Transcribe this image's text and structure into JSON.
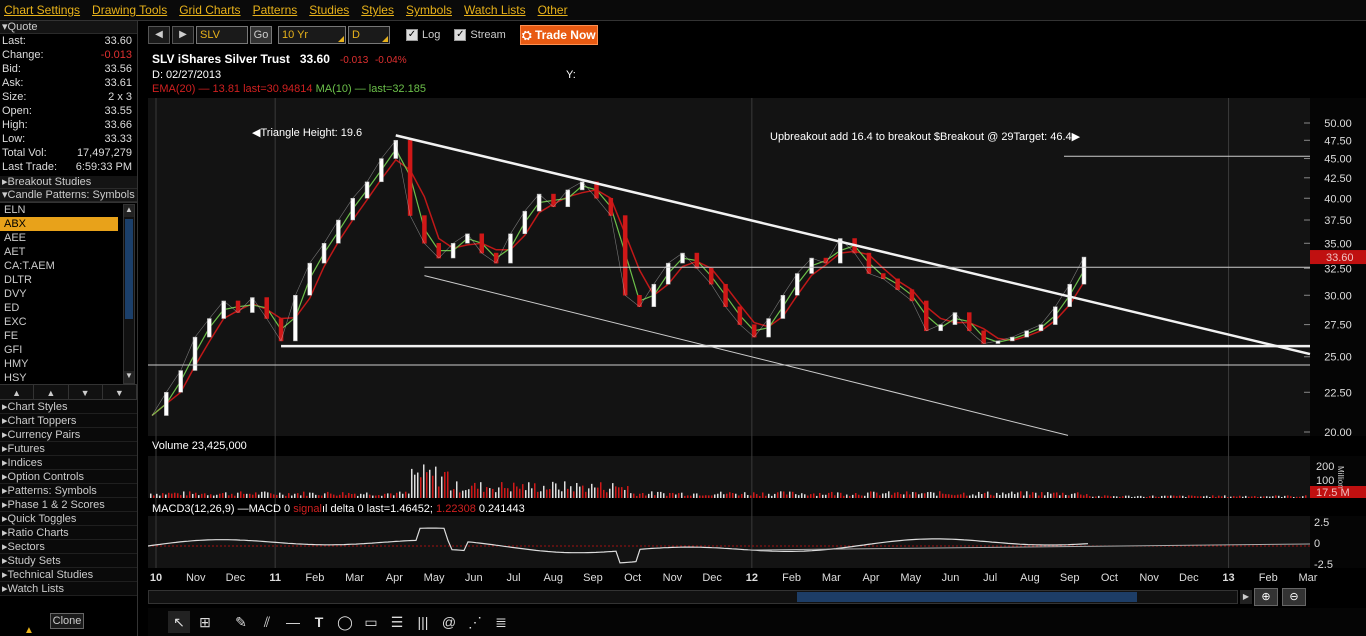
{
  "menu": [
    "Chart Settings",
    "Drawing Tools",
    "Grid Charts",
    "Patterns",
    "Studies",
    "Styles",
    "Symbols",
    "Watch Lists",
    "Other"
  ],
  "quote": {
    "header": "Quote",
    "rows": [
      {
        "label": "Last:",
        "value": "33.60"
      },
      {
        "label": "Change:",
        "value": "-0.013"
      },
      {
        "label": "Bid:",
        "value": "33.56"
      },
      {
        "label": "Ask:",
        "value": "33.61"
      },
      {
        "label": "Size:",
        "value": "2 x 3"
      },
      {
        "label": "Open:",
        "value": "33.55"
      },
      {
        "label": "High:",
        "value": "33.66"
      },
      {
        "label": "Low:",
        "value": "33.33"
      },
      {
        "label": "Total Vol:",
        "value": "17,497,279"
      },
      {
        "label": "Last Trade:",
        "value": "6:59:33 PM"
      }
    ]
  },
  "sections": {
    "breakout": "Breakout Studies",
    "candle": "Candle Patterns: Symbols"
  },
  "symbols": [
    "ELN",
    "ABX",
    "AEE",
    "AET",
    "CA:T.AEM",
    "DLTR",
    "DVY",
    "ED",
    "EXC",
    "FE",
    "GFI",
    "HMY",
    "HSY"
  ],
  "selected_symbol": "ABX",
  "list_toolbar": [
    "▲",
    "▲",
    "▼",
    "▼"
  ],
  "collapsibles": [
    "Chart Styles",
    "Chart Toppers",
    "Currency Pairs",
    "Futures",
    "Indices",
    "Option Controls",
    "Patterns: Symbols",
    "Phase 1 & 2 Scores",
    "Quick Toggles",
    "Ratio Charts",
    "Sectors",
    "Study Sets",
    "Technical Studies",
    "Watch Lists"
  ],
  "clone_label": "Clone",
  "toolbar": {
    "symbol": "SLV",
    "go": "Go",
    "period": "10 Yr",
    "interval": "D",
    "log_label": "Log",
    "stream_label": "Stream",
    "trade_label": "Trade Now"
  },
  "header": {
    "title": "SLV iShares Silver Trust",
    "last": "33.60",
    "change": "-0.013",
    "change_pct": "-0.04%",
    "date": "D: 02/27/2013",
    "y_label": "Y:",
    "ema_label": "EMA(20)",
    "ema_value": "— 13.81 last=30.94814",
    "ma_label": "MA(10)",
    "ma_value": "— last=32.185"
  },
  "annotations": {
    "triangle": "Triangle Height: 19.6",
    "breakout": "Upbreakout add 16.4 to breakout $Breakout @ 29Target: 46.4"
  },
  "volume": {
    "label": "Volume 23,425,000",
    "axis_unit": "Million",
    "current": "17.5 M"
  },
  "macd": {
    "label": "MACD3(12,26,9)",
    "macd_part": "—MACD 0",
    "signal_part": "signal",
    "delta_part": "ıl delta 0 last=1.46452;",
    "red_value": "1.22308",
    "last_value": "0.241443"
  },
  "price_axis_ticks": [
    "50.00",
    "47.50",
    "45.00",
    "42.50",
    "40.00",
    "37.50",
    "35.00",
    "32.50",
    "30.00",
    "27.50",
    "25.00",
    "22.50",
    "20.00"
  ],
  "price_tag": "33.60",
  "macd_axis_ticks": [
    "2.5",
    "0",
    "-2.5"
  ],
  "volume_axis_ticks": [
    "200",
    "100"
  ],
  "x_axis_labels": [
    "10",
    "Nov",
    "Dec",
    "11",
    "Feb",
    "Mar",
    "Apr",
    "May",
    "Jun",
    "Jul",
    "Aug",
    "Sep",
    "Oct",
    "Nov",
    "Dec",
    "12",
    "Feb",
    "Mar",
    "Apr",
    "May",
    "Jun",
    "Jul",
    "Aug",
    "Sep",
    "Oct",
    "Nov",
    "Dec",
    "13",
    "Feb",
    "Mar"
  ],
  "chart_data": {
    "type": "line",
    "series": [
      {
        "name": "SLV iShares Silver Trust",
        "values": [
          21.0,
          22.5,
          24.0,
          26.5,
          28.0,
          29.5,
          28.5,
          29.8,
          28.0,
          26.2,
          30.0,
          33.0,
          35.0,
          37.5,
          40.0,
          42.0,
          45.0,
          47.5,
          38.0,
          35.0,
          33.5,
          35.0,
          36.0,
          34.0,
          33.0,
          36.0,
          38.5,
          40.5,
          39.0,
          41.0,
          42.0,
          40.0,
          38.0,
          30.0,
          29.0,
          31.0,
          33.0,
          34.0,
          32.5,
          31.0,
          29.0,
          27.5,
          26.5,
          28.0,
          30.0,
          32.0,
          33.5,
          33.0,
          35.5,
          34.0,
          32.0,
          31.5,
          30.5,
          29.5,
          27.0,
          27.5,
          28.5,
          27.0,
          26.0,
          26.2,
          26.5,
          27.0,
          27.5,
          29.0,
          31.0,
          33.6
        ]
      }
    ],
    "ylim": [
      20,
      50
    ],
    "log_scale": true,
    "volume_ylim": [
      0,
      200
    ],
    "macd_ylim": [
      -2.5,
      2.5
    ]
  },
  "drawbar_icons": [
    "pointer-icon",
    "crosshair-icon",
    "pencil-icon",
    "parallel-lines-icon",
    "horizontal-line-icon",
    "text-icon",
    "ellipse-icon",
    "rectangle-icon",
    "fibonacci-icon",
    "cycle-lines-icon",
    "spiral-icon",
    "fan-icon",
    "grid-lines-icon"
  ]
}
